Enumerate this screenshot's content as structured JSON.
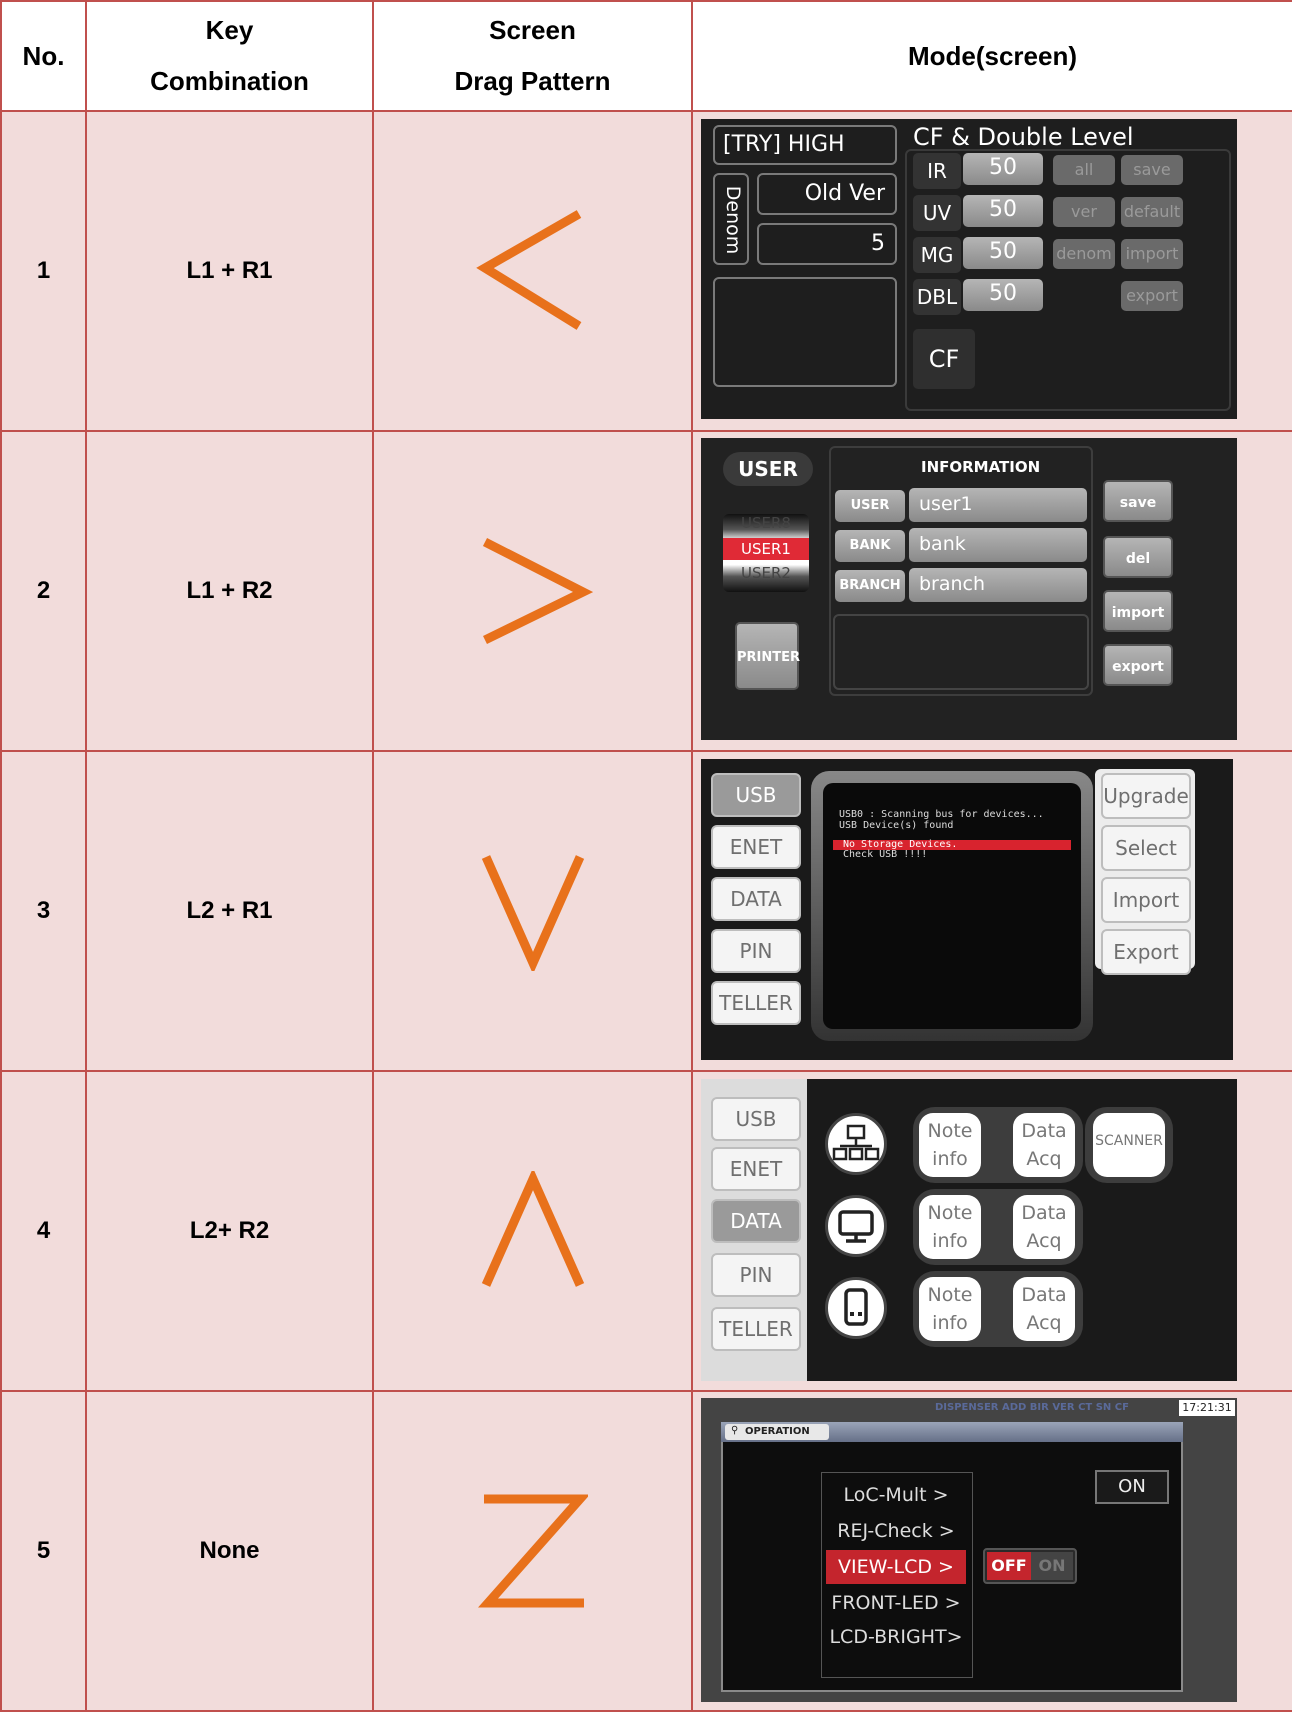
{
  "header": {
    "no": "No.",
    "key_line1": "Key",
    "key_line2": "Combination",
    "drag_line1": "Screen",
    "drag_line2": "Drag Pattern",
    "mode": "Mode(screen)"
  },
  "accent_color": "#e8711b",
  "rows": [
    {
      "no": "1",
      "combo": "L1 + R1",
      "pattern": "<"
    },
    {
      "no": "2",
      "combo": "L1 + R2",
      "pattern": ">"
    },
    {
      "no": "3",
      "combo": "L2 + R1",
      "pattern": "V"
    },
    {
      "no": "4",
      "combo": "L2+ R2",
      "pattern": "Λ"
    },
    {
      "no": "5",
      "combo": "None",
      "pattern": "Z"
    }
  ],
  "screen1": {
    "mode_box": "[TRY] HIGH",
    "title": "CF & Double Level",
    "denom_label": "Denom",
    "version": "Old Ver",
    "denom_value": "5",
    "levels": [
      {
        "name": "IR",
        "value": "50"
      },
      {
        "name": "UV",
        "value": "50"
      },
      {
        "name": "MG",
        "value": "50"
      },
      {
        "name": "DBL",
        "value": "50"
      }
    ],
    "buttons": [
      "all",
      "save",
      "ver",
      "default",
      "denom",
      "import",
      "export"
    ],
    "cf": "CF"
  },
  "screen2": {
    "user_tab": "USER",
    "info_title": "INFORMATION",
    "users": [
      "USER8",
      "USER1",
      "USER2"
    ],
    "fields": [
      {
        "label": "USER",
        "value": "user1"
      },
      {
        "label": "BANK",
        "value": "bank"
      },
      {
        "label": "BRANCH",
        "value": "branch"
      }
    ],
    "printer": "PRINTER",
    "buttons": [
      "save",
      "del",
      "import",
      "export"
    ]
  },
  "screen3": {
    "tabs": [
      "USB",
      "ENET",
      "DATA",
      "PIN",
      "TELLER"
    ],
    "console": [
      "USB0 : Scanning bus for devices...",
      "USB Device(s) found",
      "No Storage Devices.",
      "Check USB !!!!"
    ],
    "buttons": [
      "Upgrade",
      "Select",
      "Import",
      "Export"
    ]
  },
  "screen4": {
    "tabs": [
      "USB",
      "ENET",
      "DATA",
      "PIN",
      "TELLER"
    ],
    "note_line1": "Note",
    "note_line2": "info",
    "data_line1": "Data",
    "data_line2": "Acq",
    "scanner": "SCANNER"
  },
  "screen5": {
    "status": "DISPENSER ADD BIR VER CT SN CF",
    "time": "17:21:31",
    "title": "OPERATION",
    "menu": [
      "LoC-Mult >",
      "REJ-Check >",
      "VIEW-LCD >",
      "FRONT-LED >",
      "LCD-BRIGHT>"
    ],
    "on_button": "ON",
    "toggle_off": "OFF",
    "toggle_on": "ON"
  }
}
